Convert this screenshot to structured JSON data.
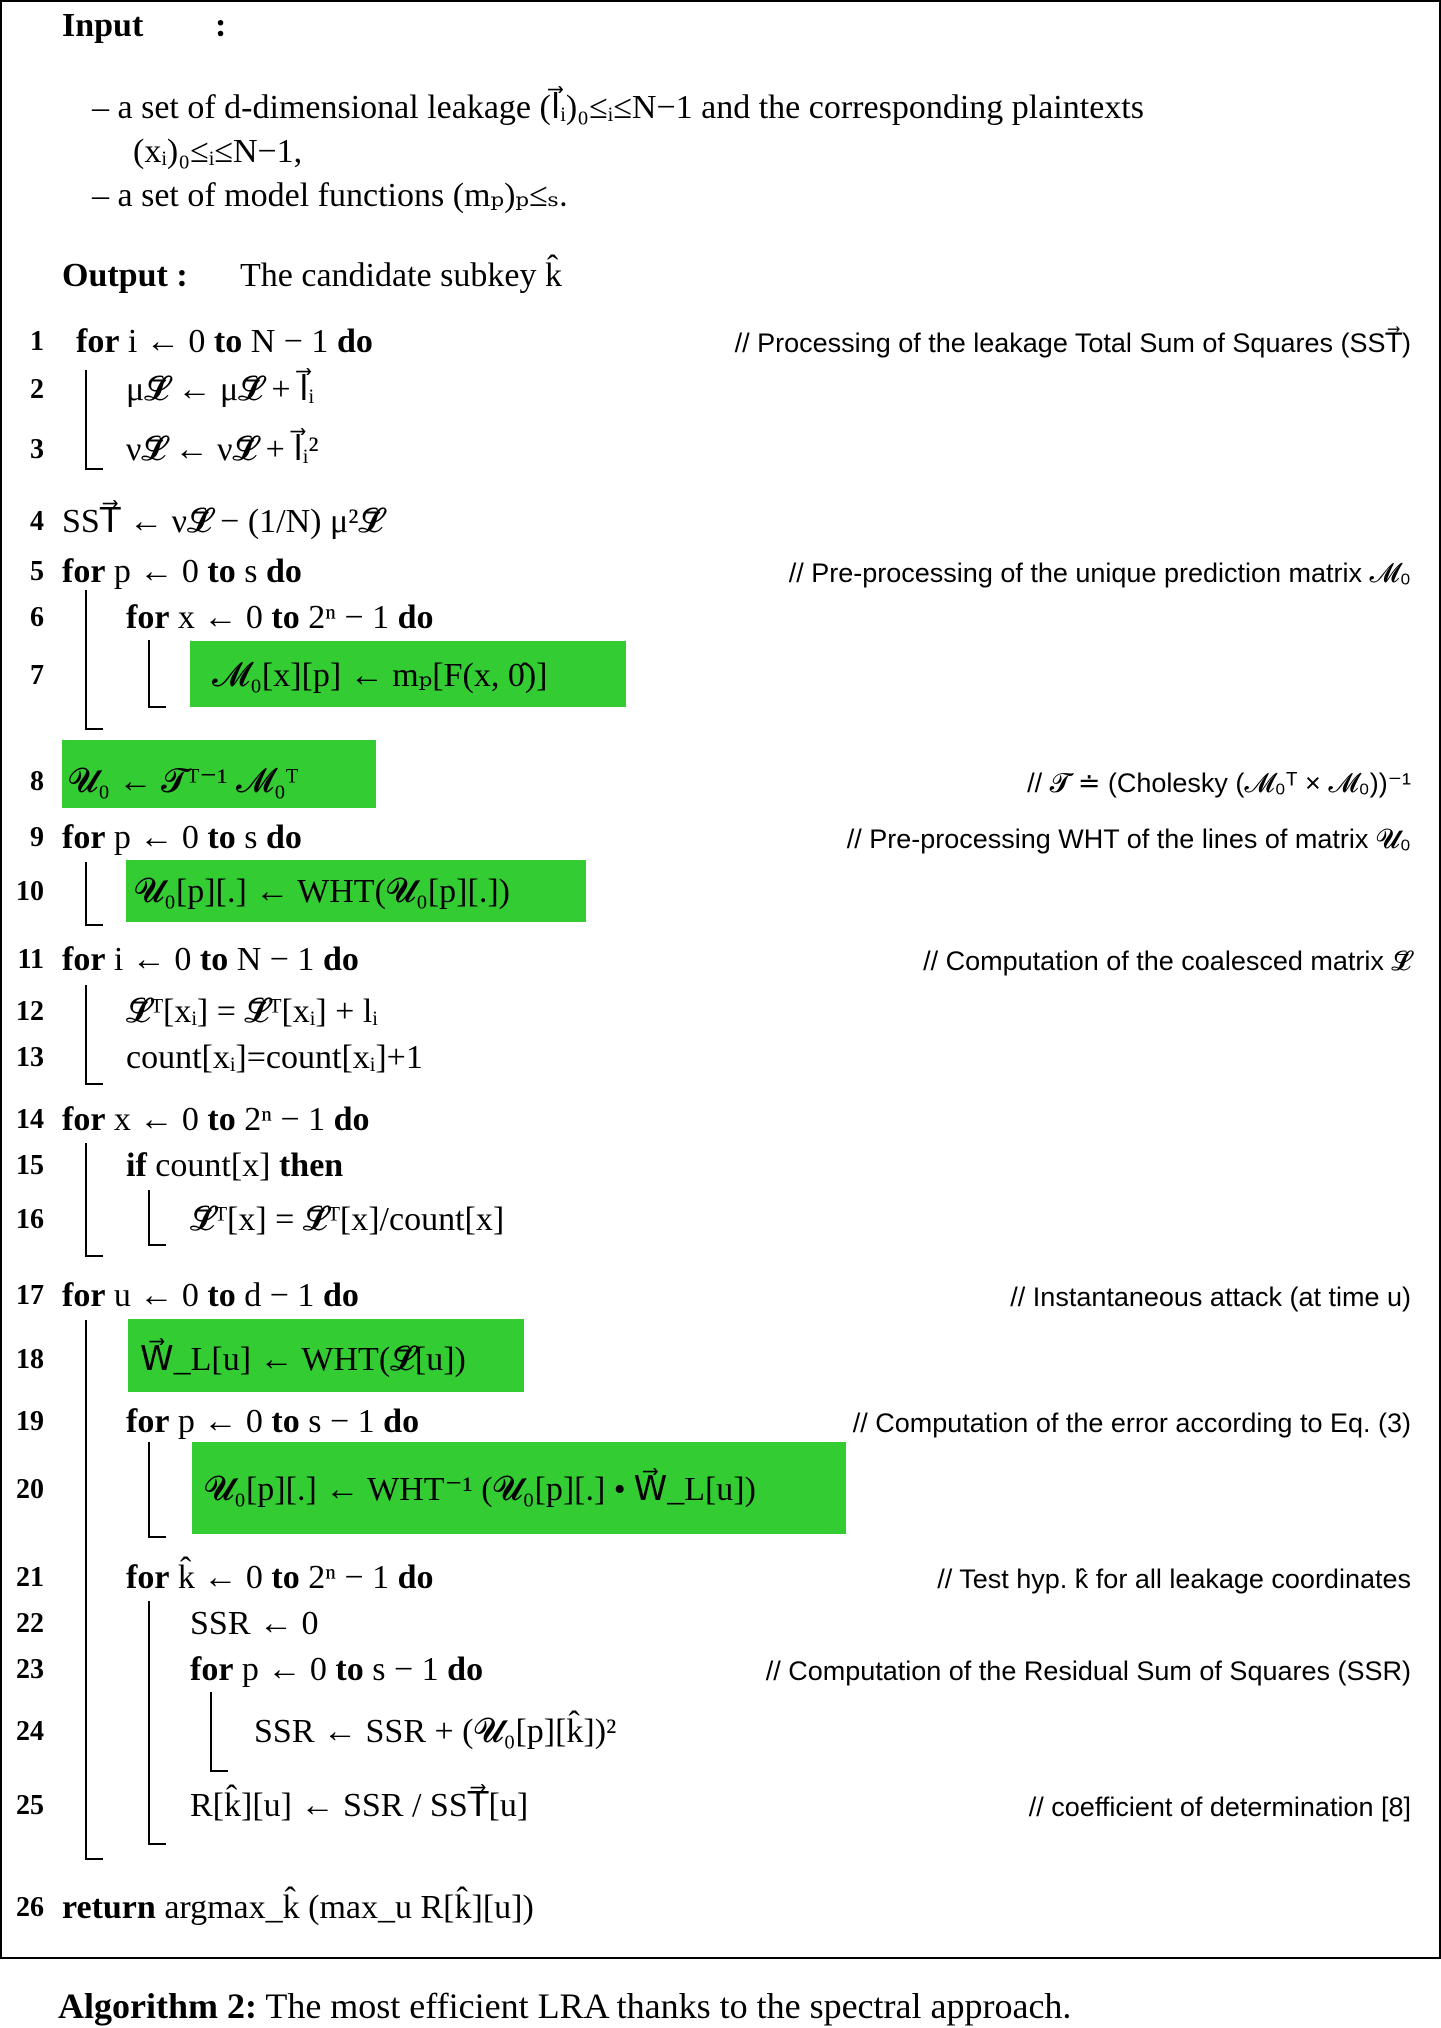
{
  "header": {
    "input_label": "Input",
    "input_colon": ":",
    "input_items": [
      "– a set of d-dimensional leakage (l⃗ᵢ)₀≤ᵢ≤N−1 and the corresponding plaintexts",
      "(xᵢ)₀≤ᵢ≤N−1,",
      "– a set of model functions (mₚ)ₚ≤ₛ."
    ],
    "output_label": "Output :",
    "output_text": "The candidate subkey k̂"
  },
  "lines": [
    {
      "n": "1",
      "code": "for i ← 0  to N − 1 do",
      "comment": "// Processing of the leakage Total Sum of Squares (SST⃗)"
    },
    {
      "n": "2",
      "code": "μ𝓛⃗ ← μ𝓛⃗ + l⃗ᵢ"
    },
    {
      "n": "3",
      "code": "ν𝓛⃗ ← ν𝓛⃗ + l⃗ᵢ²"
    },
    {
      "n": "4",
      "code": "SST⃗ ← ν𝓛⃗ − (1/N) μ²𝓛⃗"
    },
    {
      "n": "5",
      "code": "for p ← 0  to s  do",
      "comment": "// Pre-processing of the unique prediction matrix 𝓜₀"
    },
    {
      "n": "6",
      "code": "for x ← 0  to 2ⁿ − 1 do"
    },
    {
      "n": "7",
      "code": "𝓜₀[x][p] ← mₚ[F(x, 0̂)]",
      "highlight": true
    },
    {
      "n": "8",
      "code": "𝓤₀ ← 𝓣ᵀ⁻¹ 𝓜₀ᵀ",
      "highlight": true,
      "comment": "// 𝓣 ≐ (Cholesky (𝓜₀ᵀ × 𝓜₀))⁻¹"
    },
    {
      "n": "9",
      "code": "for p ← 0  to s do",
      "comment": "// Pre-processing WHT of the lines of matrix 𝓤₀"
    },
    {
      "n": "10",
      "code": "𝓤₀[p][.] ← WHT(𝓤₀[p][.])",
      "highlight": true
    },
    {
      "n": "11",
      "code": "for i ← 0  to N − 1 do",
      "comment": "// Computation of the coalesced matrix 𝓛⃗"
    },
    {
      "n": "12",
      "code": "𝓛⃗ᵀ[xᵢ] = 𝓛⃗ᵀ[xᵢ] + lᵢ"
    },
    {
      "n": "13",
      "code": "count[xᵢ]=count[xᵢ]+1"
    },
    {
      "n": "14",
      "code": "for x ← 0  to 2ⁿ − 1 do"
    },
    {
      "n": "15",
      "code": "if count[x] then"
    },
    {
      "n": "16",
      "code": "𝓛⃗ᵀ[x] = 𝓛⃗ᵀ[x]/count[x]"
    },
    {
      "n": "17",
      "code": "for u ← 0  to d − 1 do",
      "comment": "// Instantaneous attack (at time u)"
    },
    {
      "n": "18",
      "code": "W⃗_L[u] ← WHT(𝓛⃗[u])",
      "highlight": true
    },
    {
      "n": "19",
      "code": "for p ← 0  to s − 1  do",
      "comment": "// Computation of the error according to Eq. (3)"
    },
    {
      "n": "20",
      "code": "𝓤₀[p][.] ← WHT⁻¹ (𝓤₀[p][.] • W⃗_L[u])",
      "highlight": true
    },
    {
      "n": "21",
      "code": "for k̂ ← 0  to 2ⁿ − 1 do",
      "comment": "// Test hyp. k̂ for all leakage coordinates"
    },
    {
      "n": "22",
      "code": "SSR ← 0"
    },
    {
      "n": "23",
      "code": "for p ← 0  to s − 1 do",
      "comment": "// Computation of the Residual Sum of Squares (SSR)"
    },
    {
      "n": "24",
      "code": "SSR ← SSR + (𝓤₀[p][k̂])²"
    },
    {
      "n": "25",
      "code": "R[k̂][u] ← SSR / SST⃗[u]",
      "comment": "// coefficient of determination [8]"
    },
    {
      "n": "26",
      "code": "return argmax_k̂ (max_u R[k̂][u])"
    }
  ],
  "caption": {
    "label": "Algorithm 2:",
    "text": "The most efficient LRA thanks to the spectral approach."
  },
  "colors": {
    "highlight": "#33cc33"
  }
}
